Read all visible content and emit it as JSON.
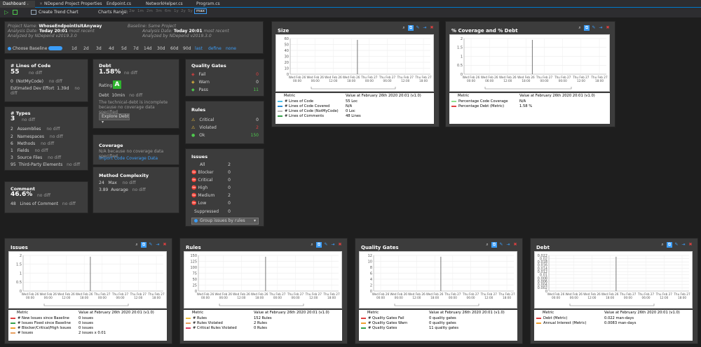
{
  "tabs": [
    {
      "label": "Dashboard",
      "active": true
    },
    {
      "label": "NDepend Project Properties"
    },
    {
      "label": "Endpoint.cs"
    },
    {
      "label": "NetworkHelper.cs"
    },
    {
      "label": "Program.cs"
    }
  ],
  "toolbar": {
    "create_trend_chart": "Create Trend Chart",
    "charts_range_label": "Charts Range:",
    "range_options": [
      "1w",
      "2w",
      "1m",
      "2m",
      "3m",
      "6m",
      "1y",
      "2y",
      "5y",
      "max"
    ],
    "range_selected": "max"
  },
  "project": {
    "project_name_label": "Project Name:",
    "project_name": "WhoseEndpointIsItAnyway",
    "analysis_date_label": "Analysis Date:",
    "analysis_date": "Today 20:01",
    "analysis_note": "most recent",
    "analyzed_by": "Analyzed by NDepend v2019.3.0",
    "baseline_label": "Baseline:",
    "baseline_value": "Same Project",
    "baseline_analysis_date_label": "Analysis Date:",
    "baseline_analysis_date": "Today 20:01",
    "baseline_analysis_note": "most recent",
    "baseline_analyzed_by": "Analyzed by NDepend v2019.3.0",
    "choose_baseline": "Choose Baseline",
    "baseline_ranges": [
      "1d",
      "2d",
      "3d",
      "4d",
      "5d",
      "7d",
      "14d",
      "30d",
      "60d",
      "90d"
    ],
    "baseline_links": [
      "last",
      "define",
      "none"
    ]
  },
  "loc": {
    "title": "# Lines of Code",
    "value": "55",
    "nodiff": "no diff",
    "rows": [
      {
        "num": "0",
        "label": "(NotMyCode)",
        "nodiff": "no diff"
      },
      {
        "num": "",
        "label": "Estimated Dev Effort",
        "extra": "1.39d",
        "nodiff": "no diff"
      }
    ]
  },
  "debt": {
    "title": "Debt",
    "value": "1.58%",
    "nodiff": "no diff",
    "rating_label": "Rating",
    "rating": "A",
    "debt_label": "Debt",
    "debt_value": "10min",
    "debt_nodiff": "no diff",
    "note": "The technical-debt is incomplete because no coverage data specified",
    "explore": "Explore Debt"
  },
  "quality_gates": {
    "title": "Quality Gates",
    "rows": [
      {
        "label": "Fail",
        "value": "0"
      },
      {
        "label": "Warn",
        "value": "0"
      },
      {
        "label": "Pass",
        "value": "11"
      }
    ]
  },
  "types": {
    "title": "# Types",
    "value": "3",
    "nodiff": "no diff",
    "rows": [
      {
        "num": "2",
        "label": "Assemblies",
        "nodiff": "no diff"
      },
      {
        "num": "2",
        "label": "Namespaces",
        "nodiff": "no diff"
      },
      {
        "num": "6",
        "label": "Methods",
        "nodiff": "no diff"
      },
      {
        "num": "1",
        "label": "Fields",
        "nodiff": "no diff"
      },
      {
        "num": "3",
        "label": "Source Files",
        "nodiff": "no diff"
      },
      {
        "num": "95",
        "label": "Third-Party Elements",
        "nodiff": "no diff"
      }
    ]
  },
  "rules": {
    "title": "Rules",
    "rows": [
      {
        "label": "Critical",
        "value": "0"
      },
      {
        "label": "Violated",
        "value": "2"
      },
      {
        "label": "Ok",
        "value": "150"
      }
    ]
  },
  "coverage": {
    "title": "Coverage",
    "note": "N/A because no coverage data specified",
    "import": "Import Code Coverage Data"
  },
  "comment": {
    "title": "Comment",
    "value": "46.6%",
    "nodiff": "no diff",
    "row": {
      "num": "48",
      "label": "Lines of Comment",
      "nodiff": "no diff"
    }
  },
  "complexity": {
    "title": "Method Complexity",
    "rows": [
      {
        "num": "24",
        "label": "Max",
        "nodiff": "no diff"
      },
      {
        "num": "3.89",
        "label": "Average",
        "nodiff": "no diff"
      }
    ]
  },
  "issues": {
    "title": "Issues",
    "rows": [
      {
        "label": "All",
        "value": "2"
      },
      {
        "label": "Blocker",
        "value": "0"
      },
      {
        "label": "Critical",
        "value": "0"
      },
      {
        "label": "High",
        "value": "0"
      },
      {
        "label": "Medium",
        "value": "2"
      },
      {
        "label": "Low",
        "value": "0"
      },
      {
        "label": "Suppressed",
        "value": "0"
      }
    ],
    "group_select": "Group issues by rules"
  },
  "chart_common": {
    "x_ticks": [
      {
        "d": "Wed Feb 26",
        "t": "00:00"
      },
      {
        "d": "Wed Feb 26",
        "t": "06:00"
      },
      {
        "d": "Wed Feb 26",
        "t": "12:00"
      },
      {
        "d": "Wed Feb 26",
        "t": "18:00"
      },
      {
        "d": "Thu Feb 27",
        "t": "00:00"
      },
      {
        "d": "Thu Feb 27",
        "t": "06:00"
      },
      {
        "d": "Thu Feb 27",
        "t": "12:00"
      },
      {
        "d": "Thu Feb 27",
        "t": "18:00"
      }
    ],
    "metric_header": "Metric",
    "value_header": "Value at February 26th 2020  20:01  (v1.0)"
  },
  "chart_data": [
    {
      "id": "size",
      "type": "line",
      "title": "Size",
      "ylim": [
        0,
        60
      ],
      "yticks": [
        "60",
        "50",
        "40",
        "30",
        "20",
        "10",
        "0"
      ],
      "series": [
        {
          "name": "# Lines of Code",
          "color": "#4fc1e9",
          "value": "55 Loc"
        },
        {
          "name": "# Lines of Code Covered",
          "color": "#2a8fd6",
          "value": "N/A"
        },
        {
          "name": "# Lines of Code (NotMyCode)",
          "color": "#bdbdbd",
          "value": "0 Loc"
        },
        {
          "name": "# Lines of Comments",
          "color": "#35a04a",
          "value": "48 Lines"
        }
      ]
    },
    {
      "id": "coverage",
      "type": "line",
      "title": "% Coverage and % Debt",
      "ylim": [
        0,
        2
      ],
      "yticks": [
        "2",
        "1.5",
        "1",
        "0.5",
        "0"
      ],
      "series": [
        {
          "name": "Percentage Code Coverage",
          "color": "#8ee08e",
          "value": "N/A"
        },
        {
          "name": "Percentage Debt (Metric)",
          "color": "#e04040",
          "value": "1.58 %"
        }
      ]
    },
    {
      "id": "issues",
      "type": "line",
      "title": "Issues",
      "ylim": [
        0,
        2
      ],
      "yticks": [
        "2",
        "1.5",
        "1",
        "0.5",
        "0"
      ],
      "series": [
        {
          "name": "# New Issues since Baseline",
          "color": "#e04040",
          "value": "0 issues"
        },
        {
          "name": "# Issues Fixed since Baseline",
          "color": "#35a04a",
          "value": "0 issues"
        },
        {
          "name": "# Blocker/Critical/High Issues",
          "color": "#f0a030",
          "value": "0 issues"
        },
        {
          "name": "# Issues",
          "color": "#e8a060",
          "value": "2 issues   x 0.01"
        }
      ]
    },
    {
      "id": "rules",
      "type": "line",
      "title": "Rules",
      "ylim": [
        0,
        150
      ],
      "yticks": [
        "150",
        "125",
        "100",
        "75",
        "50",
        "25",
        "0"
      ],
      "series": [
        {
          "name": "# Rules",
          "color": "#f0c040",
          "value": "152 Rules"
        },
        {
          "name": "# Rules Violated",
          "color": "#e8a060",
          "value": "2 Rules"
        },
        {
          "name": "# Critical Rules Violated",
          "color": "#e04060",
          "value": "0 Rules"
        }
      ]
    },
    {
      "id": "qualitygates",
      "type": "line",
      "title": "Quality Gates",
      "ylim": [
        0,
        12
      ],
      "yticks": [
        "12",
        "10",
        "8",
        "6",
        "4",
        "2",
        "0"
      ],
      "series": [
        {
          "name": "# Quality Gates Fail",
          "color": "#e04040",
          "value": "0 quality gates"
        },
        {
          "name": "# Quality Gates Warn",
          "color": "#f0a030",
          "value": "0 quality gates"
        },
        {
          "name": "# Quality Gates",
          "color": "#35a04a",
          "value": "11 quality gates"
        }
      ]
    },
    {
      "id": "debt",
      "type": "line",
      "title": "Debt",
      "ylim": [
        0,
        0.02
      ],
      "yticks": [
        "0.022",
        "0.02",
        "0.018",
        "0.016",
        "0.014",
        "0.012",
        "0.01",
        "0.008",
        "0.006",
        "0.004",
        "0.002",
        "0"
      ],
      "series": [
        {
          "name": "Debt (Metric)",
          "color": "#e04040",
          "value": "0.022 man-days"
        },
        {
          "name": "Annual Interest (Metric)",
          "color": "#f0a030",
          "value": "0.0083 man-days"
        }
      ]
    }
  ]
}
